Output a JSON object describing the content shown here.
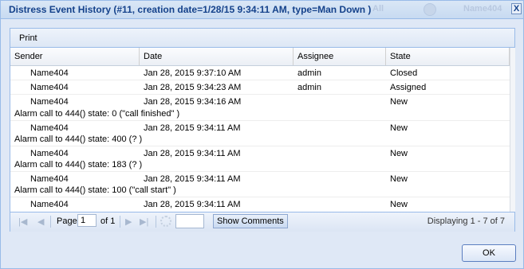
{
  "window": {
    "title": "Distress Event History (#11, creation date=1/28/15 9:34:11 AM, type=Man Down )",
    "background_text_left": "All",
    "background_text_right": "Name404",
    "close_glyph": "X"
  },
  "toolbar": {
    "print_label": "Print"
  },
  "grid": {
    "columns": [
      "Sender",
      "Date",
      "Assignee",
      "State"
    ],
    "rows": [
      {
        "sender": "Name404",
        "date": "Jan 28, 2015 9:37:10 AM",
        "assignee": "admin",
        "state": "Closed",
        "comment": ""
      },
      {
        "sender": "Name404",
        "date": "Jan 28, 2015 9:34:23 AM",
        "assignee": "admin",
        "state": "Assigned",
        "comment": ""
      },
      {
        "sender": "Name404",
        "date": "Jan 28, 2015 9:34:16 AM",
        "assignee": "",
        "state": "New",
        "comment": "Alarm call to 444() state: 0 (\"call finished\" )"
      },
      {
        "sender": "Name404",
        "date": "Jan 28, 2015 9:34:11 AM",
        "assignee": "",
        "state": "New",
        "comment": "Alarm call to 444() state: 400 (? )"
      },
      {
        "sender": "Name404",
        "date": "Jan 28, 2015 9:34:11 AM",
        "assignee": "",
        "state": "New",
        "comment": "Alarm call to 444() state: 183 (? )"
      },
      {
        "sender": "Name404",
        "date": "Jan 28, 2015 9:34:11 AM",
        "assignee": "",
        "state": "New",
        "comment": "Alarm call to 444() state: 100 (\"call start\" )"
      },
      {
        "sender": "Name404",
        "date": "Jan 28, 2015 9:34:11 AM",
        "assignee": "",
        "state": "New",
        "comment": ""
      }
    ]
  },
  "pager": {
    "page_label": "Page",
    "page_value": "1",
    "of_label": "of 1",
    "page_size_value": "",
    "show_comments_label": "Show Comments",
    "displaying": "Displaying 1 - 7 of 7",
    "first_glyph": "|◀",
    "prev_glyph": "◀",
    "next_glyph": "▶",
    "last_glyph": "▶|"
  },
  "footer": {
    "ok_label": "OK"
  }
}
